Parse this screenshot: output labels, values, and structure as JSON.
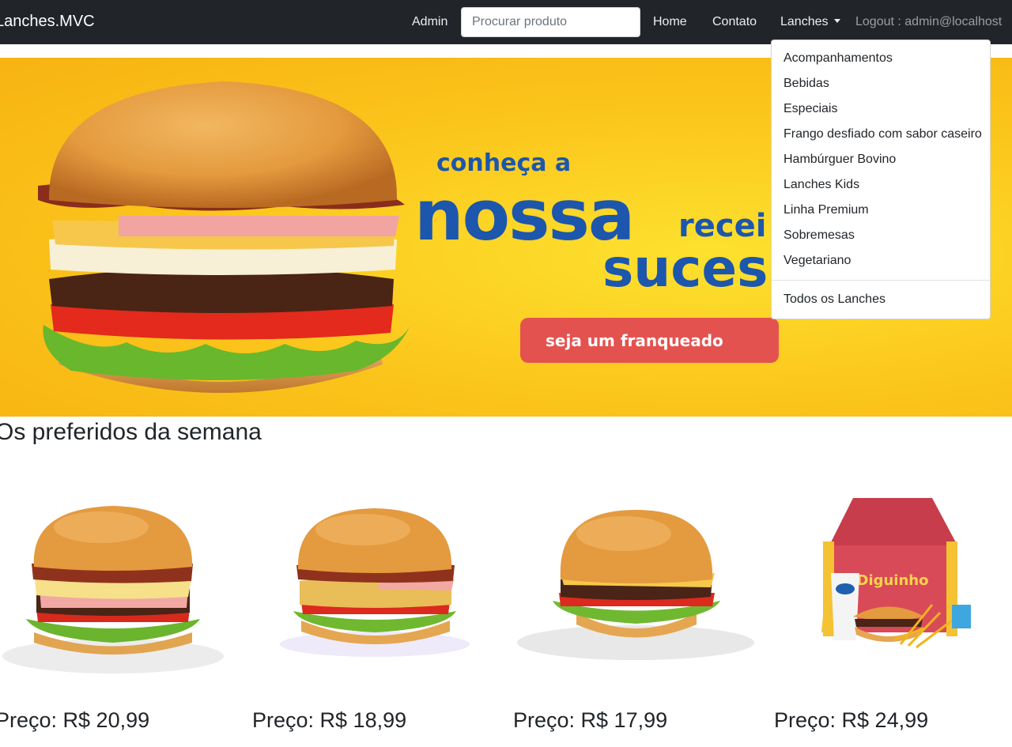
{
  "navbar": {
    "brand": "Lanches.MVC",
    "admin_link": "Admin",
    "search_placeholder": "Procurar produto",
    "home_link": "Home",
    "contato_link": "Contato",
    "lanches_link": "Lanches",
    "logout_link": "Logout : admin@localhost"
  },
  "dropdown": {
    "items": [
      "Acompanhamentos",
      "Bebidas",
      "Especiais",
      "Frango desfiado com sabor caseiro",
      "Hambúrguer Bovino",
      "Lanches Kids",
      "Linha Premium",
      "Sobremesas",
      "Vegetariano"
    ],
    "all_label": "Todos os Lanches"
  },
  "banner": {
    "line1": "conheça a",
    "line2": "nossa",
    "line3": "recei",
    "line4": "suces",
    "button_label": "seja um franqueado",
    "colors": {
      "background": "#fbc41b",
      "text": "#1c56ad",
      "button": "#e4524f"
    }
  },
  "section": {
    "title": "Os preferidos da semana"
  },
  "products": [
    {
      "price": "Preço: R$ 20,99",
      "icon": "burger-bacon-egg"
    },
    {
      "price": "Preço: R$ 18,99",
      "icon": "burger-chicken"
    },
    {
      "price": "Preço: R$ 17,99",
      "icon": "burger-classic"
    },
    {
      "price": "Preço: R$ 24,99",
      "icon": "kids-combo",
      "box_text": "Diguinho"
    }
  ]
}
